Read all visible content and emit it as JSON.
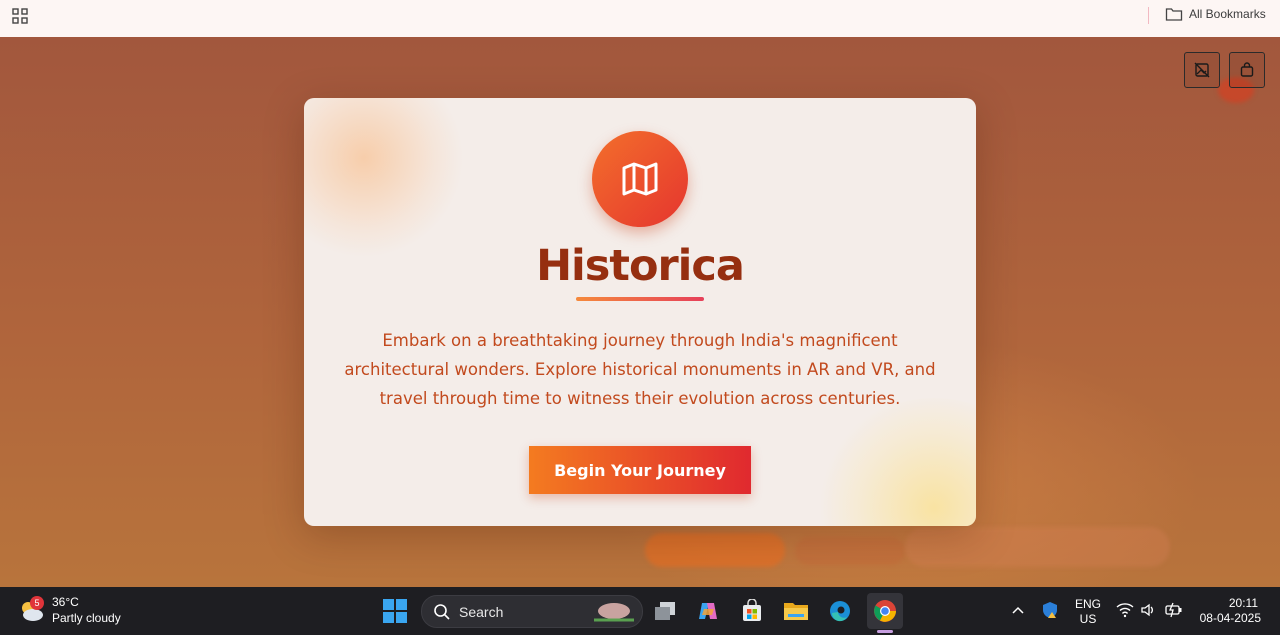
{
  "bookmarks_bar": {
    "all_bookmarks_label": "All Bookmarks"
  },
  "modal": {
    "icon": "map-icon",
    "title": "Historica",
    "description": "Embark on a breathtaking journey through India's magnificent architectural wonders. Explore historical monuments in AR and VR, and travel through time to witness their evolution across centuries.",
    "cta_label": "Begin Your Journey"
  },
  "page_controls": {
    "icons": [
      "no-image-icon",
      "bag-icon"
    ]
  },
  "taskbar": {
    "weather": {
      "temperature": "36°C",
      "condition": "Partly cloudy",
      "badge": "5"
    },
    "search_placeholder": "Search",
    "language_line1": "ENG",
    "language_line2": "US",
    "time": "20:11",
    "date": "08-04-2025",
    "apps": [
      "start-icon",
      "task-view-icon",
      "copilot-icon",
      "microsoft-store-icon",
      "file-explorer-icon",
      "edge-icon",
      "chrome-icon"
    ]
  },
  "colors": {
    "accent_orange": "#f36f2c",
    "accent_red": "#e0292f",
    "title_color": "#962f10",
    "text_color": "#c24a1e"
  }
}
